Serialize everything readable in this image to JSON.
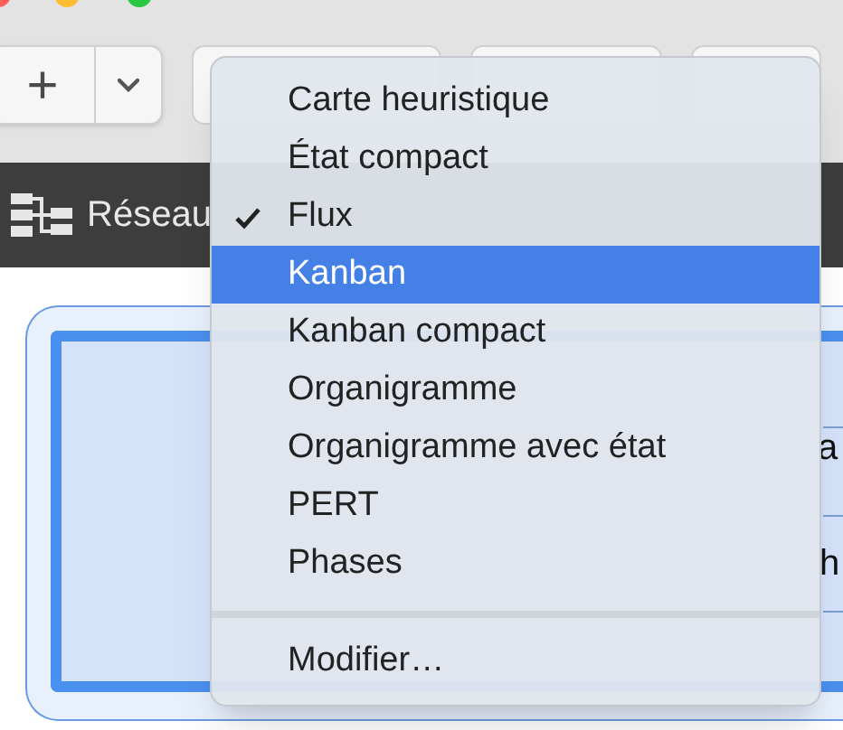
{
  "toolbar": {
    "add_button": "+"
  },
  "view_bar": {
    "label": "Réseau"
  },
  "background_fragments": [
    "a",
    "h"
  ],
  "menu": {
    "items": [
      {
        "kind": "item",
        "label": "Carte heuristique",
        "checked": false,
        "selected": false
      },
      {
        "kind": "item",
        "label": "État compact",
        "checked": false,
        "selected": false
      },
      {
        "kind": "item",
        "label": "Flux",
        "checked": true,
        "selected": false
      },
      {
        "kind": "item",
        "label": "Kanban",
        "checked": false,
        "selected": true
      },
      {
        "kind": "item",
        "label": "Kanban compact",
        "checked": false,
        "selected": false
      },
      {
        "kind": "item",
        "label": "Organigramme",
        "checked": false,
        "selected": false
      },
      {
        "kind": "item",
        "label": "Organigramme avec état",
        "checked": false,
        "selected": false
      },
      {
        "kind": "item",
        "label": "PERT",
        "checked": false,
        "selected": false
      },
      {
        "kind": "item",
        "label": "Phases",
        "checked": false,
        "selected": false
      },
      {
        "kind": "separator"
      },
      {
        "kind": "item",
        "label": "Modifier…",
        "checked": false,
        "selected": false
      }
    ]
  }
}
